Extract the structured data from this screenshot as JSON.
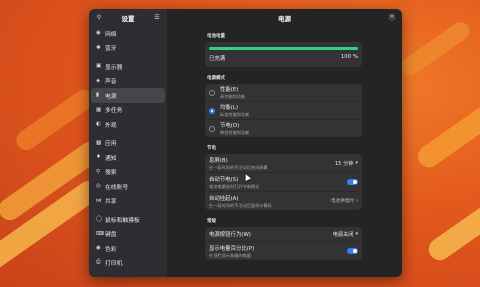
{
  "sidebar": {
    "title": "设置",
    "items": [
      {
        "label": "网络",
        "icon": "wifi-icon"
      },
      {
        "label": "蓝牙",
        "icon": "bluetooth-icon"
      },
      {
        "label": "显示器",
        "icon": "display-icon"
      },
      {
        "label": "声音",
        "icon": "speaker-icon"
      },
      {
        "label": "电源",
        "icon": "battery-icon"
      },
      {
        "label": "多任务",
        "icon": "multitask-icon"
      },
      {
        "label": "外观",
        "icon": "appearance-icon"
      },
      {
        "label": "应用",
        "icon": "apps-icon"
      },
      {
        "label": "通知",
        "icon": "bell-icon"
      },
      {
        "label": "搜索",
        "icon": "search-icon"
      },
      {
        "label": "在线账号",
        "icon": "accounts-icon"
      },
      {
        "label": "共享",
        "icon": "share-icon"
      },
      {
        "label": "鼠标和触摸板",
        "icon": "mouse-icon"
      },
      {
        "label": "键盘",
        "icon": "keyboard-icon"
      },
      {
        "label": "色彩",
        "icon": "color-icon"
      },
      {
        "label": "打印机",
        "icon": "printer-icon"
      }
    ]
  },
  "main": {
    "title": "电源",
    "battery": {
      "section": "电池电量",
      "status": "已充满",
      "percent_label": "100 %",
      "level": 1.0
    },
    "mode": {
      "section": "电源模式",
      "options": [
        {
          "title": "性能(E)",
          "sub": "高性能和功耗",
          "selected": false
        },
        {
          "title": "均衡(L)",
          "sub": "标准性能和功耗",
          "selected": true
        },
        {
          "title": "节电(O)",
          "sub": "降低性能和功耗",
          "selected": false
        }
      ]
    },
    "saving": {
      "section": "节电",
      "blank": {
        "title": "息屏(B)",
        "sub": "在一段时间的不活动后关闭屏幕",
        "value": "15 分钟"
      },
      "auto_saver": {
        "title": "自动节电(S)",
        "sub": "电池电量低时打开节电模式",
        "on": true
      },
      "auto_suspend": {
        "title": "自动挂起(A)",
        "sub": "在一段时间的不活动后暂停计算机",
        "value": "电池供电时"
      }
    },
    "general": {
      "section": "常规",
      "button": {
        "title": "电源按钮行为(W)",
        "value": "电源关闭"
      },
      "show_percent": {
        "title": "显示电量百分比(P)",
        "sub": "在顶栏显示准确的电量",
        "on": true
      }
    }
  },
  "colors": {
    "accent": "#3584e4",
    "battery": "#33d17a",
    "wallpaper": "#e65a1e"
  }
}
